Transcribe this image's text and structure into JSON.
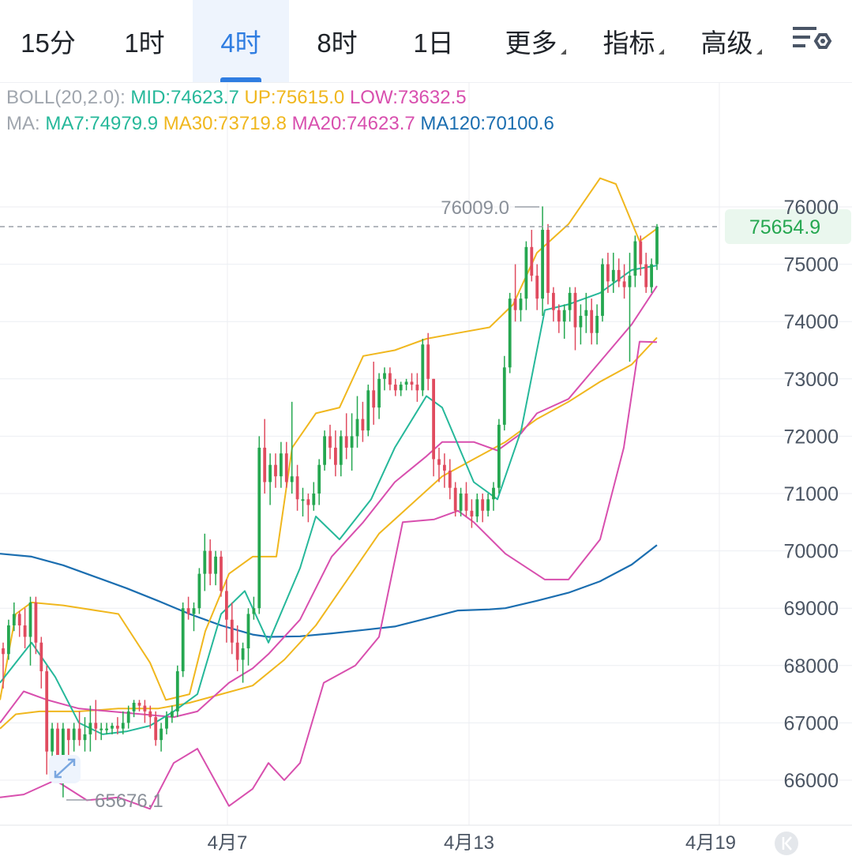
{
  "tabs": [
    {
      "label": "15分",
      "active": false,
      "dropdown": false
    },
    {
      "label": "1时",
      "active": false,
      "dropdown": false
    },
    {
      "label": "4时",
      "active": true,
      "dropdown": false
    },
    {
      "label": "8时",
      "active": false,
      "dropdown": false
    },
    {
      "label": "1日",
      "active": false,
      "dropdown": false
    },
    {
      "label": "更多",
      "active": false,
      "dropdown": true
    },
    {
      "label": "指标",
      "active": false,
      "dropdown": true
    },
    {
      "label": "高级",
      "active": false,
      "dropdown": true
    }
  ],
  "settings_icon": "chart-settings-icon",
  "boll": {
    "prefix": "BOLL(20,2.0):",
    "mid": "MID:74623.7",
    "up": "UP:75615.0",
    "low": "LOW:73632.5"
  },
  "ma": {
    "prefix": "MA:",
    "ma7": "MA7:74979.9",
    "ma30": "MA30:73719.8",
    "ma20": "MA20:74623.7",
    "ma120": "MA120:70100.6"
  },
  "colors": {
    "up": "#25a750",
    "down": "#e04b5f",
    "mid": "#26b89a",
    "upper": "#f0b71e",
    "lower": "#d84fae",
    "ma120": "#1b6eb0",
    "ma30": "#f0b71e",
    "grid": "#eceef2"
  },
  "chart_data": {
    "type": "candlestick",
    "y_ticks": [
      76000,
      75000,
      74000,
      73000,
      72000,
      71000,
      70000,
      69000,
      68000,
      67000,
      66000
    ],
    "ylim": [
      65400,
      76900
    ],
    "x_labels": [
      "4月7",
      "4月13",
      "4月19"
    ],
    "last_price": "75654.9",
    "max_marker": "76009.0",
    "min_marker": "65676.1",
    "candles": [
      [
        68300,
        68400,
        67600,
        68200
      ],
      [
        68200,
        68800,
        68100,
        68700
      ],
      [
        68700,
        69100,
        68600,
        68900
      ],
      [
        68900,
        68950,
        68500,
        68700
      ],
      [
        68700,
        69000,
        68300,
        68500
      ],
      [
        68500,
        69200,
        68000,
        69100
      ],
      [
        69100,
        69200,
        68200,
        68400
      ],
      [
        68400,
        68500,
        67600,
        67900
      ],
      [
        67900,
        68000,
        66100,
        66500
      ],
      [
        66500,
        67000,
        66200,
        66900
      ],
      [
        66900,
        67000,
        66000,
        66200
      ],
      [
        66200,
        67000,
        65700,
        66900
      ],
      [
        66900,
        66900,
        66300,
        66700
      ],
      [
        66700,
        67000,
        66500,
        66900
      ],
      [
        66900,
        67200,
        66600,
        66700
      ],
      [
        66700,
        67100,
        66500,
        66800
      ],
      [
        66800,
        67300,
        66500,
        67000
      ],
      [
        67000,
        67400,
        66700,
        66900
      ],
      [
        66900,
        67000,
        66700,
        66900
      ],
      [
        66900,
        67000,
        66800,
        66900
      ],
      [
        66900,
        67000,
        66800,
        66950
      ],
      [
        66950,
        67100,
        66800,
        66900
      ],
      [
        66900,
        67200,
        66800,
        67000
      ],
      [
        67000,
        67300,
        66900,
        67200
      ],
      [
        67200,
        67400,
        67100,
        67350
      ],
      [
        67350,
        67400,
        67200,
        67300
      ],
      [
        67300,
        67400,
        67000,
        67200
      ],
      [
        67200,
        67300,
        66900,
        67100
      ],
      [
        67100,
        67200,
        66600,
        66700
      ],
      [
        66700,
        67000,
        66500,
        66900
      ],
      [
        66900,
        67200,
        66800,
        67100
      ],
      [
        67100,
        67300,
        67000,
        67200
      ],
      [
        67200,
        68000,
        67100,
        67900
      ],
      [
        67900,
        69100,
        67800,
        69000
      ],
      [
        69000,
        69200,
        68800,
        68900
      ],
      [
        68900,
        69100,
        68600,
        69000
      ],
      [
        69000,
        69700,
        68900,
        69600
      ],
      [
        69600,
        70300,
        69300,
        70000
      ],
      [
        70000,
        70200,
        69400,
        69600
      ],
      [
        69600,
        70000,
        69400,
        69900
      ],
      [
        69900,
        70000,
        69200,
        69300
      ],
      [
        69300,
        69500,
        68400,
        68800
      ],
      [
        68800,
        69100,
        68200,
        68400
      ],
      [
        68400,
        68700,
        67900,
        68100
      ],
      [
        68100,
        68400,
        67700,
        68300
      ],
      [
        68300,
        69000,
        68000,
        68900
      ],
      [
        68900,
        69200,
        68800,
        69000
      ],
      [
        69000,
        72000,
        68900,
        71800
      ],
      [
        71800,
        72300,
        71000,
        71200
      ],
      [
        71200,
        71700,
        70800,
        71500
      ],
      [
        71500,
        71700,
        71100,
        71300
      ],
      [
        71300,
        71900,
        71100,
        71700
      ],
      [
        71700,
        71900,
        71100,
        71200
      ],
      [
        71200,
        72600,
        71000,
        71300
      ],
      [
        71300,
        71500,
        70700,
        70900
      ],
      [
        70900,
        71100,
        70600,
        70900
      ],
      [
        70900,
        71000,
        70500,
        70800
      ],
      [
        70800,
        71200,
        70700,
        71000
      ],
      [
        71000,
        71600,
        70800,
        71500
      ],
      [
        71500,
        72100,
        71400,
        72000
      ],
      [
        72000,
        72200,
        71600,
        71800
      ],
      [
        71800,
        72100,
        71300,
        71500
      ],
      [
        71500,
        72100,
        71300,
        72000
      ],
      [
        72000,
        72400,
        71600,
        71800
      ],
      [
        71800,
        72400,
        71400,
        72000
      ],
      [
        72000,
        72700,
        71800,
        72300
      ],
      [
        72300,
        72600,
        71900,
        72100
      ],
      [
        72100,
        72900,
        72000,
        72800
      ],
      [
        72800,
        73300,
        72200,
        72500
      ],
      [
        72500,
        73100,
        72300,
        73000
      ],
      [
        73000,
        73200,
        72800,
        73100
      ],
      [
        73100,
        73200,
        72800,
        72900
      ],
      [
        72900,
        73000,
        72700,
        72800
      ],
      [
        72800,
        72950,
        72700,
        72900
      ],
      [
        72900,
        73000,
        72800,
        72950
      ],
      [
        72950,
        73100,
        72800,
        72900
      ],
      [
        72900,
        73100,
        72600,
        72800
      ],
      [
        72800,
        73700,
        72700,
        73600
      ],
      [
        73600,
        73800,
        72800,
        73000
      ],
      [
        73000,
        73000,
        71300,
        71600
      ],
      [
        71600,
        71800,
        71200,
        71500
      ],
      [
        71500,
        71700,
        71100,
        71400
      ],
      [
        71400,
        71600,
        70900,
        71100
      ],
      [
        71100,
        71200,
        70600,
        70700
      ],
      [
        70700,
        71100,
        70600,
        71000
      ],
      [
        71000,
        71200,
        70600,
        70700
      ],
      [
        70700,
        70900,
        70400,
        70600
      ],
      [
        70600,
        71000,
        70500,
        70900
      ],
      [
        70900,
        71000,
        70500,
        70700
      ],
      [
        70700,
        71000,
        70600,
        70900
      ],
      [
        70900,
        71200,
        70700,
        71100
      ],
      [
        71100,
        72300,
        71000,
        72200
      ],
      [
        72200,
        73400,
        72100,
        73200
      ],
      [
        73200,
        74500,
        73100,
        74400
      ],
      [
        74400,
        75000,
        74000,
        74200
      ],
      [
        74200,
        74500,
        74000,
        74400
      ],
      [
        74400,
        75400,
        74200,
        75300
      ],
      [
        75300,
        75600,
        74700,
        74800
      ],
      [
        74800,
        75000,
        74200,
        74400
      ],
      [
        74400,
        76009,
        74100,
        75600
      ],
      [
        75600,
        75700,
        74300,
        74500
      ],
      [
        74500,
        74600,
        74000,
        74200
      ],
      [
        74200,
        74300,
        73800,
        74000
      ],
      [
        74000,
        74300,
        73700,
        74200
      ],
      [
        74200,
        74600,
        74000,
        74500
      ],
      [
        74500,
        74600,
        73500,
        73900
      ],
      [
        73900,
        74300,
        73600,
        74100
      ],
      [
        74100,
        74500,
        73800,
        74200
      ],
      [
        74200,
        74400,
        73600,
        73800
      ],
      [
        73800,
        74300,
        73600,
        74100
      ],
      [
        74100,
        75100,
        74000,
        75000
      ],
      [
        75000,
        75200,
        74500,
        74700
      ],
      [
        74700,
        75200,
        74500,
        74900
      ],
      [
        74900,
        75100,
        74600,
        74700
      ],
      [
        74700,
        75000,
        74400,
        74600
      ],
      [
        74600,
        75200,
        73300,
        74800
      ],
      [
        74800,
        75500,
        74600,
        75400
      ],
      [
        75400,
        75500,
        74800,
        75000
      ],
      [
        75000,
        75200,
        74500,
        74600
      ],
      [
        74600,
        75100,
        74500,
        75000
      ],
      [
        75000,
        75700,
        74900,
        75654.9
      ]
    ],
    "ma120": [
      [
        0,
        69950
      ],
      [
        40,
        69900
      ],
      [
        80,
        69750
      ],
      [
        120,
        69550
      ],
      [
        160,
        69350
      ],
      [
        200,
        69130
      ],
      [
        240,
        68900
      ],
      [
        280,
        68700
      ],
      [
        320,
        68540
      ],
      [
        340,
        68500
      ],
      [
        380,
        68510
      ],
      [
        420,
        68560
      ],
      [
        460,
        68620
      ],
      [
        500,
        68680
      ],
      [
        540,
        68820
      ],
      [
        580,
        68960
      ],
      [
        620,
        68980
      ],
      [
        640,
        69000
      ],
      [
        680,
        69130
      ],
      [
        720,
        69270
      ],
      [
        760,
        69470
      ],
      [
        800,
        69760
      ],
      [
        832,
        70100
      ]
    ],
    "ma30": [
      [
        0,
        66900
      ],
      [
        20,
        67150
      ],
      [
        50,
        67200
      ],
      [
        100,
        67200
      ],
      [
        150,
        67250
      ],
      [
        200,
        67250
      ],
      [
        240,
        67350
      ],
      [
        280,
        67500
      ],
      [
        320,
        67650
      ],
      [
        360,
        68100
      ],
      [
        400,
        68700
      ],
      [
        440,
        69500
      ],
      [
        480,
        70300
      ],
      [
        520,
        70800
      ],
      [
        560,
        71300
      ],
      [
        600,
        71600
      ],
      [
        640,
        71900
      ],
      [
        680,
        72300
      ],
      [
        720,
        72600
      ],
      [
        760,
        72950
      ],
      [
        800,
        73250
      ],
      [
        832,
        73720
      ]
    ],
    "mid": [
      [
        0,
        67000
      ],
      [
        30,
        67550
      ],
      [
        60,
        67400
      ],
      [
        100,
        67250
      ],
      [
        140,
        67200
      ],
      [
        180,
        67150
      ],
      [
        220,
        67100
      ],
      [
        250,
        67200
      ],
      [
        290,
        67700
      ],
      [
        320,
        67950
      ],
      [
        340,
        68200
      ],
      [
        380,
        68800
      ],
      [
        420,
        69900
      ],
      [
        460,
        70500
      ],
      [
        500,
        71200
      ],
      [
        540,
        71650
      ],
      [
        560,
        71900
      ],
      [
        600,
        71900
      ],
      [
        630,
        71750
      ],
      [
        660,
        72050
      ],
      [
        680,
        72400
      ],
      [
        720,
        72650
      ],
      [
        760,
        73300
      ],
      [
        800,
        73950
      ],
      [
        832,
        74620
      ]
    ],
    "upper": [
      [
        0,
        67400
      ],
      [
        20,
        68900
      ],
      [
        40,
        69100
      ],
      [
        80,
        69050
      ],
      [
        150,
        68900
      ],
      [
        190,
        68050
      ],
      [
        210,
        67400
      ],
      [
        240,
        67500
      ],
      [
        260,
        68600
      ],
      [
        290,
        69600
      ],
      [
        320,
        69900
      ],
      [
        350,
        69900
      ],
      [
        370,
        71800
      ],
      [
        400,
        72400
      ],
      [
        430,
        72500
      ],
      [
        460,
        73400
      ],
      [
        500,
        73500
      ],
      [
        540,
        73700
      ],
      [
        580,
        73800
      ],
      [
        620,
        73900
      ],
      [
        650,
        74300
      ],
      [
        680,
        75200
      ],
      [
        720,
        75700
      ],
      [
        760,
        76500
      ],
      [
        780,
        76400
      ],
      [
        810,
        75400
      ],
      [
        832,
        75620
      ]
    ],
    "lower": [
      [
        0,
        65700
      ],
      [
        30,
        65750
      ],
      [
        70,
        66000
      ],
      [
        110,
        65650
      ],
      [
        150,
        65700
      ],
      [
        190,
        65500
      ],
      [
        220,
        66300
      ],
      [
        250,
        66550
      ],
      [
        290,
        65550
      ],
      [
        320,
        65850
      ],
      [
        340,
        66300
      ],
      [
        360,
        66000
      ],
      [
        380,
        66300
      ],
      [
        410,
        67700
      ],
      [
        450,
        68000
      ],
      [
        480,
        68500
      ],
      [
        510,
        70500
      ],
      [
        550,
        70550
      ],
      [
        580,
        70700
      ],
      [
        600,
        70500
      ],
      [
        640,
        69950
      ],
      [
        690,
        69500
      ],
      [
        720,
        69500
      ],
      [
        760,
        70200
      ],
      [
        790,
        71800
      ],
      [
        810,
        73650
      ],
      [
        832,
        73640
      ]
    ],
    "mid_short": [
      [
        0,
        67700
      ],
      [
        40,
        68400
      ],
      [
        70,
        67800
      ],
      [
        100,
        67000
      ],
      [
        130,
        66800
      ],
      [
        160,
        66850
      ],
      [
        190,
        66950
      ],
      [
        220,
        67200
      ],
      [
        250,
        67500
      ],
      [
        280,
        68900
      ],
      [
        310,
        69300
      ],
      [
        340,
        68400
      ],
      [
        380,
        69700
      ],
      [
        400,
        70600
      ],
      [
        430,
        70200
      ],
      [
        470,
        70900
      ],
      [
        500,
        71800
      ],
      [
        540,
        72700
      ],
      [
        560,
        72500
      ],
      [
        600,
        71200
      ],
      [
        630,
        70900
      ],
      [
        660,
        72100
      ],
      [
        690,
        74200
      ],
      [
        720,
        74300
      ],
      [
        760,
        74500
      ],
      [
        800,
        74900
      ],
      [
        832,
        74980
      ]
    ]
  }
}
